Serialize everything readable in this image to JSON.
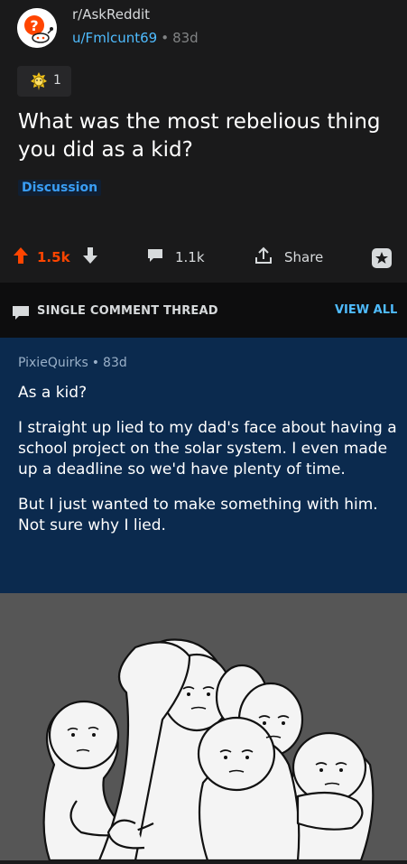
{
  "post": {
    "subreddit": "r/AskReddit",
    "author": "u/Fmlcunt69",
    "age": "83d",
    "award_count": "1",
    "title": "What was the most rebelious thing you did as a kid?",
    "flair": "Discussion",
    "upvotes": "1.5k",
    "comments": "1.1k",
    "share_label": "Share"
  },
  "thread": {
    "label": "SINGLE COMMENT THREAD",
    "view_all": "VIEW ALL"
  },
  "comment": {
    "author": "PixieQuirks",
    "age": "83d",
    "paragraphs": [
      "As a kid?",
      "I straight up lied to my dad's face about having a school project on the solar system. I even made up a deadline so we'd have plenty of time.",
      "But I just wanted to make something with him. Not sure why I lied."
    ]
  },
  "colors": {
    "accent_blue": "#4fbcff",
    "upvote_orange": "#ff4500",
    "comment_bg": "#0b2a4e"
  },
  "icons": [
    "askreddit-logo-icon",
    "award-icon",
    "upvote-icon",
    "downvote-icon",
    "comment-icon",
    "share-icon",
    "save-icon",
    "thread-icon"
  ]
}
